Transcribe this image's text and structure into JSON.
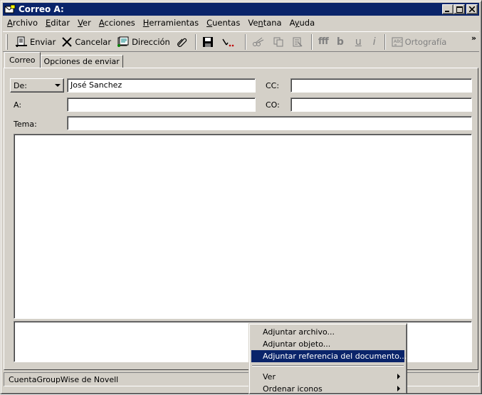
{
  "window": {
    "title": "Correo A:",
    "icon": "mail-window-icon"
  },
  "menubar": {
    "items": [
      {
        "label": "Archivo",
        "accel": "A",
        "rest": "rchivo"
      },
      {
        "label": "Editar",
        "accel": "E",
        "rest": "ditar"
      },
      {
        "label": "Ver",
        "accel": "V",
        "rest": "er"
      },
      {
        "label": "Acciones",
        "accel": "A",
        "rest": "cciones"
      },
      {
        "label": "Herramientas",
        "accel": "H",
        "rest": "erramientas"
      },
      {
        "label": "Cuentas",
        "accel": "C",
        "rest": "uentas"
      },
      {
        "label": "Ventana",
        "pre": "Ve",
        "accel": "n",
        "rest": "tana"
      },
      {
        "label": "Ayuda",
        "pre": "A",
        "accel": "y",
        "rest": "uda"
      }
    ]
  },
  "toolbar": {
    "send_label": "Enviar",
    "cancel_label": "Cancelar",
    "address_label": "Dirección",
    "spell_label": "Ortografía",
    "overflow": "»",
    "format_bold": "b",
    "format_underline": "u",
    "format_italic": "i",
    "format_font": "fff"
  },
  "tabs": [
    {
      "label": "Correo",
      "active": true
    },
    {
      "label": "Opciones de enviar",
      "active": false
    }
  ],
  "form": {
    "from_selector": "De:",
    "from_value": "José Sanchez",
    "to_label": "A:",
    "to_value": "",
    "subject_label": "Tema:",
    "subject_value": "",
    "cc_label": "CC:",
    "cc_value": "",
    "bc_label": "CO:",
    "bc_value": "",
    "body_text": ""
  },
  "statusbar": {
    "account": "CuentaGroupWise de Novell"
  },
  "context_menu": {
    "items": [
      {
        "label": "Adjuntar archivo...",
        "highlighted": false
      },
      {
        "label": "Adjuntar objeto...",
        "highlighted": false
      },
      {
        "label": "Adjuntar referencia del documento...",
        "highlighted": true
      }
    ],
    "submenu_items": [
      {
        "label": "Ver",
        "has_submenu": true
      },
      {
        "label": "Ordenar iconos",
        "has_submenu": true
      }
    ]
  },
  "colors": {
    "title_bar": "#0a246a",
    "face": "#d4d0c8",
    "highlight": "#0a246a"
  }
}
